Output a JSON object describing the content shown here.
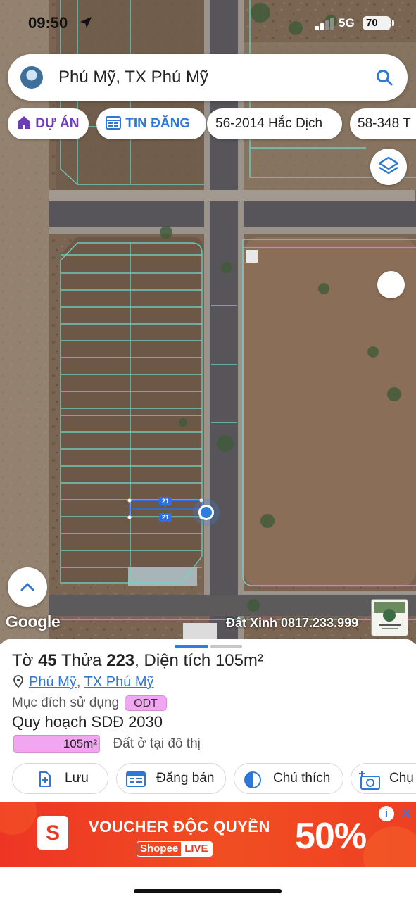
{
  "status_bar": {
    "time": "09:50",
    "network": "5G",
    "battery": "70"
  },
  "search": {
    "text": "Phú Mỹ, TX Phú Mỹ"
  },
  "chips": {
    "du_an": "DỰ ÁN",
    "tin_dang": "TIN ĐĂNG",
    "plot_a": "56-2014 Hắc Dịch",
    "plot_b": "58-348 T"
  },
  "map": {
    "plot_labels": [
      "21",
      "21"
    ],
    "attribution": "Google",
    "watermark": "Đất Xinh 0817.233.999"
  },
  "parcel": {
    "to_label": "Tờ",
    "to_value": "45",
    "thua_label": "Thửa",
    "thua_value": "223",
    "area_label": "Diện tích",
    "area_value": "105m²",
    "location_1": "Phú Mỹ",
    "location_sep": ",",
    "location_2": "TX Phú Mỹ",
    "purpose_label": "Mục đích sử dụng",
    "purpose_code": "ODT",
    "plan_title": "Quy hoạch SDĐ 2030",
    "plan_area": "105m²",
    "plan_desc": "Đất ở tại đô thị",
    "plan_share": 1.0
  },
  "actions": {
    "save": "Lưu",
    "post": "Đăng bán",
    "legend": "Chú thích",
    "photo": "Chụ"
  },
  "ad": {
    "title": "VOUCHER ĐỘC QUYỀN",
    "shopee": "Shopee",
    "live": "LIVE",
    "discount": "50%",
    "info": "i",
    "close": "✕"
  },
  "colors": {
    "accent_blue": "#2f77d6",
    "project_purple": "#6a3fb8",
    "land_pink": "#f0a6f0",
    "parcel_line": "#6fd6c8",
    "ad_red": "#ee3524"
  },
  "icons": [
    "location-arrow-icon",
    "search-icon",
    "house-icon",
    "calendar-icon",
    "layers-icon",
    "chevron-up-icon",
    "pin-icon",
    "add-file-icon",
    "list-form-icon",
    "half-circle-icon",
    "camera-plus-icon",
    "shopee-bag-icon",
    "info-icon",
    "close-icon"
  ]
}
